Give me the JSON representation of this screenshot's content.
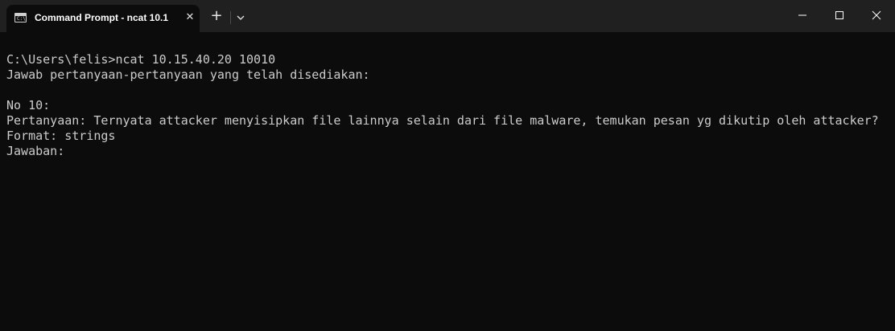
{
  "tab": {
    "title": "Command Prompt - ncat  10.1",
    "icon": "cmd-icon",
    "icon_glyph": "C:\\"
  },
  "window_controls": {
    "new_tab": "+",
    "close_tab": "✕"
  },
  "console": {
    "lines": [
      "",
      "C:\\Users\\felis>ncat 10.15.40.20 10010",
      "Jawab pertanyaan-pertanyaan yang telah disediakan:",
      "",
      "No 10:",
      "Pertanyaan: Ternyata attacker menyisipkan file lainnya selain dari file malware, temukan pesan yg dikutip oleh attacker?",
      "Format: strings",
      "Jawaban:"
    ]
  },
  "colors": {
    "titlebar": "#202020",
    "background": "#0c0c0c",
    "text": "#cccccc"
  }
}
